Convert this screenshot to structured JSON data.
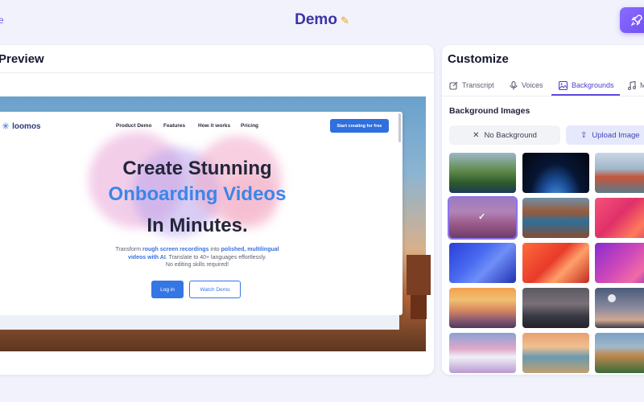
{
  "header": {
    "back_glyph": "e",
    "title": "Demo",
    "edit_icon": "pencil-icon",
    "launch_icon": "rocket-icon",
    "accent": "#6c4cf0"
  },
  "preview": {
    "title": "Preview",
    "site": {
      "logo": "loomos",
      "nav": [
        "Product Demo",
        "Features",
        "How it works",
        "Pricing"
      ],
      "cta": "Start creating for free",
      "hero_line1": "Create Stunning",
      "hero_line2": "Onboarding Videos",
      "hero_line3": "In Minutes.",
      "body_pre": "Transform ",
      "body_b1": "rough screen recordings",
      "body_mid": " into ",
      "body_b2": "polished, multilingual",
      "body_b3": "videos with AI",
      "body_post": ". Translate to 40+ languages effortlessly.",
      "body_line3": "No editing skills required!",
      "login": "Log in",
      "watch": "Watch Demo"
    }
  },
  "customize": {
    "title": "Customize",
    "tabs": [
      {
        "label": "Transcript",
        "icon": "edit-square-icon",
        "active": false
      },
      {
        "label": "Voices",
        "icon": "microphone-icon",
        "active": false
      },
      {
        "label": "Backgrounds",
        "icon": "image-icon",
        "active": true
      },
      {
        "label": "M",
        "icon": "music-note-icon",
        "active": false
      }
    ],
    "section_title": "Background Images",
    "no_background": "No Background",
    "upload": "Upload Image",
    "thumbnails": [
      {
        "name": "green-cliffs-coast",
        "selected": false
      },
      {
        "name": "earth-from-space",
        "selected": false
      },
      {
        "name": "golden-gate-bridge",
        "selected": false
      },
      {
        "name": "purple-desert-mesa",
        "selected": true
      },
      {
        "name": "canyon-lake",
        "selected": false
      },
      {
        "name": "red-pink-waves",
        "selected": false
      },
      {
        "name": "blue-waves",
        "selected": false
      },
      {
        "name": "orange-red-waves",
        "selected": false
      },
      {
        "name": "magenta-waves",
        "selected": false
      },
      {
        "name": "orange-sunset-mountains",
        "selected": false
      },
      {
        "name": "misty-dark-mountains",
        "selected": false
      },
      {
        "name": "moon-dusk-tree",
        "selected": false
      },
      {
        "name": "pink-snowy-peaks",
        "selected": false
      },
      {
        "name": "beach-sunset",
        "selected": false
      },
      {
        "name": "green-hills-mountains",
        "selected": false
      }
    ]
  }
}
